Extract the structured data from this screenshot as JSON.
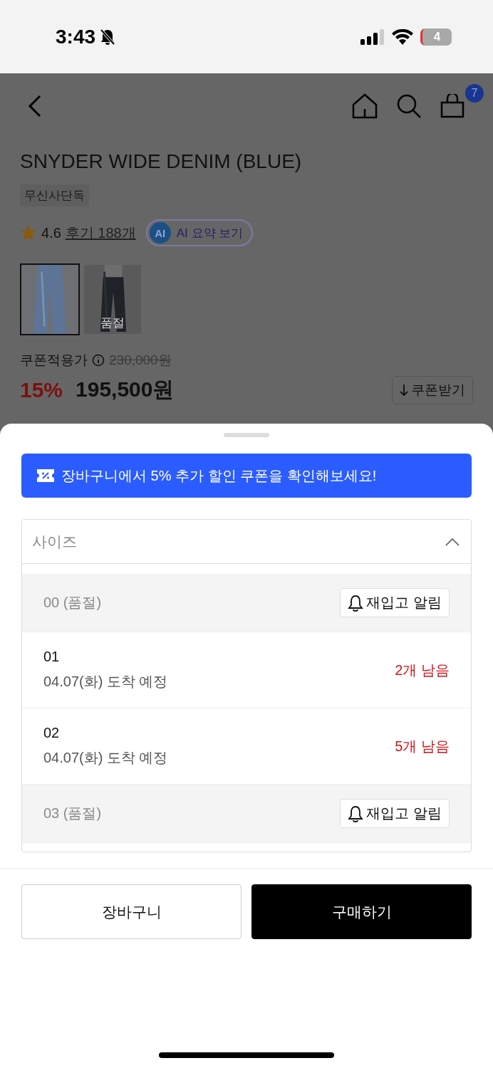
{
  "status_bar": {
    "time": "3:43",
    "battery": "4"
  },
  "header": {
    "cart_badge": "7"
  },
  "product": {
    "title": "SNYDER WIDE DENIM (BLUE)",
    "tag": "무신사단독",
    "rating": "4.6",
    "reviews": "후기 188개",
    "ai_button": {
      "badge": "AI",
      "label": "AI 요약 보기"
    },
    "thumbnails": [
      {
        "selected": true,
        "kind": "picture"
      },
      {
        "selected": false,
        "kind": "picture",
        "overlay": "품절"
      }
    ],
    "price_label": "쿠폰적용가",
    "original_price": "230,000원",
    "discount": "15%",
    "price": "195,500원",
    "coupon_button": "쿠폰받기"
  },
  "sheet": {
    "banner": "장바구니에서 5% 추가 할인 쿠폰을 확인해보세요!",
    "select": {
      "placeholder": "사이즈",
      "expanded": true
    },
    "options": [
      {
        "kind": "sold_out",
        "label": "00 (품절)",
        "restock_button": "재입고 알림"
      },
      {
        "kind": "available",
        "label": "01",
        "delivery": "04.07(화) 도착 예정",
        "stock": "2개 남음"
      },
      {
        "kind": "available",
        "label": "02",
        "delivery": "04.07(화) 도착 예정",
        "stock": "5개 남음"
      },
      {
        "kind": "sold_out",
        "label": "03 (품절)",
        "restock_button": "재입고 알림"
      }
    ],
    "buttons": {
      "cart": "장바구니",
      "buy": "구매하기"
    }
  }
}
